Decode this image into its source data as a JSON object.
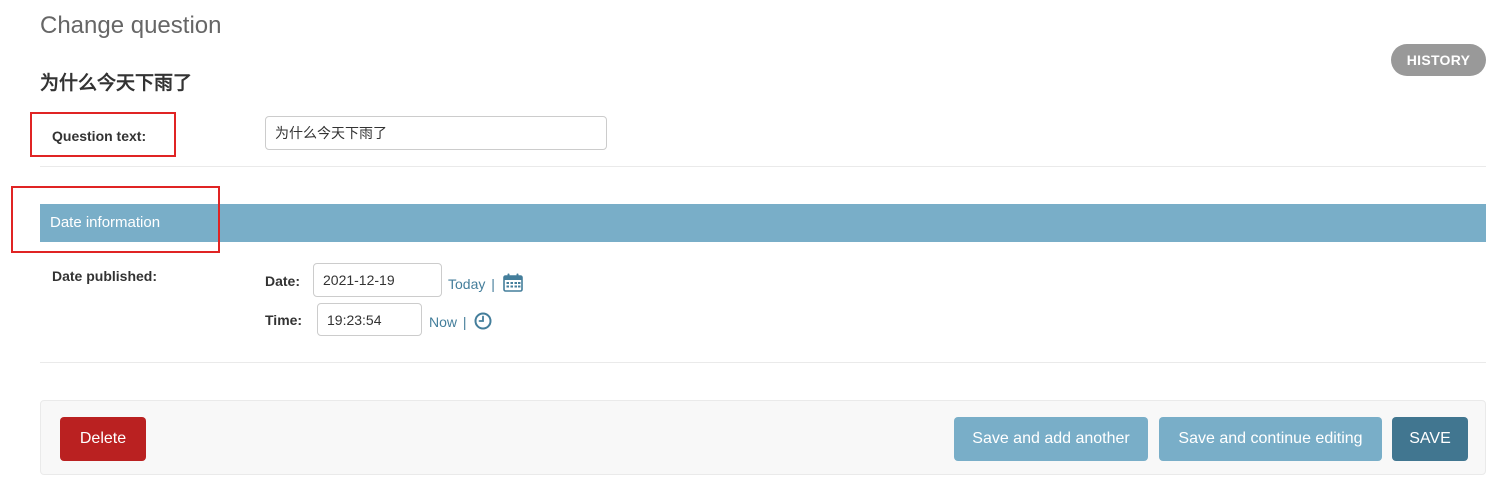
{
  "page": {
    "title": "Change question",
    "history_label": "HISTORY",
    "object_title": "为什么今天下雨了"
  },
  "form": {
    "question_text": {
      "label": "Question text:",
      "value": "为什么今天下雨了"
    },
    "date_section": {
      "title": "Date information",
      "date_published_label": "Date published:",
      "date": {
        "label": "Date:",
        "value": "2021-12-19",
        "shortcut": "Today",
        "separator": "|",
        "icon": "calendar-icon"
      },
      "time": {
        "label": "Time:",
        "value": "19:23:54",
        "shortcut": "Now",
        "separator": "|",
        "icon": "clock-icon"
      }
    }
  },
  "submit_row": {
    "delete_label": "Delete",
    "save_add_another_label": "Save and add another",
    "save_continue_label": "Save and continue editing",
    "save_label": "SAVE"
  },
  "colors": {
    "section_header": "#79aec8",
    "primary_button": "#417690",
    "secondary_button": "#79aec8",
    "delete_button": "#ba2121",
    "link": "#447e9b",
    "history_button": "#999999",
    "highlight_annotation": "#e02424"
  }
}
